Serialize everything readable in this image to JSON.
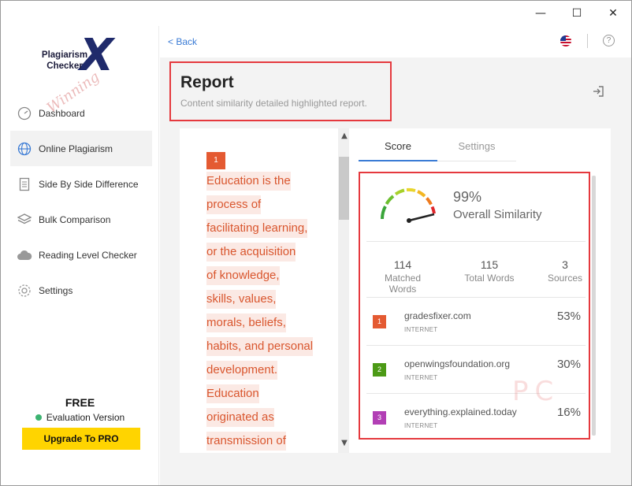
{
  "window": {
    "minimize": "—",
    "maximize": "☐",
    "close": "✕"
  },
  "logo": {
    "line1": "Plagiarism",
    "line2": "Checker",
    "mark": "X",
    "watermark": "Winning"
  },
  "nav": {
    "items": [
      {
        "label": "Dashboard",
        "icon": "gauge-icon"
      },
      {
        "label": "Online Plagiarism",
        "icon": "globe-icon"
      },
      {
        "label": "Side By Side Difference",
        "icon": "document-icon"
      },
      {
        "label": "Bulk Comparison",
        "icon": "layers-icon"
      },
      {
        "label": "Reading Level Checker",
        "icon": "cloud-icon"
      },
      {
        "label": "Settings",
        "icon": "gear-icon"
      }
    ]
  },
  "plan": {
    "title": "FREE",
    "subtitle": "Evaluation Version",
    "upgrade": "Upgrade To PRO"
  },
  "topbar": {
    "back": "< Back",
    "help": "?"
  },
  "report": {
    "title": "Report",
    "subtitle": "Content similarity detailed highlighted report."
  },
  "text": {
    "segment_number": "1",
    "lines": [
      "Education is the",
      "process of",
      "facilitating learning,",
      "or the acquisition",
      "of knowledge,",
      "skills, values,",
      "morals, beliefs,",
      "habits, and personal",
      "development.",
      "Education",
      "originated as",
      "transmission of"
    ]
  },
  "tabs": {
    "score": "Score",
    "settings": "Settings"
  },
  "score": {
    "percent": "99%",
    "label": "Overall Similarity",
    "stats": [
      {
        "value": "114",
        "label": "Matched Words"
      },
      {
        "value": "115",
        "label": "Total Words"
      },
      {
        "value": "3",
        "label": "Sources"
      }
    ],
    "sources": [
      {
        "num": "1",
        "name": "gradesfixer.com",
        "type": "INTERNET",
        "pct": "53%",
        "color": "#e45a32"
      },
      {
        "num": "2",
        "name": "openwingsfoundation.org",
        "type": "INTERNET",
        "pct": "30%",
        "color": "#4c9a16"
      },
      {
        "num": "3",
        "name": "everything.explained.today",
        "type": "INTERNET",
        "pct": "16%",
        "color": "#b23fb5"
      }
    ]
  },
  "colors": {
    "accent": "#3a7bd5",
    "highlight": "#e5393e",
    "upgrade": "#ffd400"
  },
  "overlay_watermark": "PC"
}
